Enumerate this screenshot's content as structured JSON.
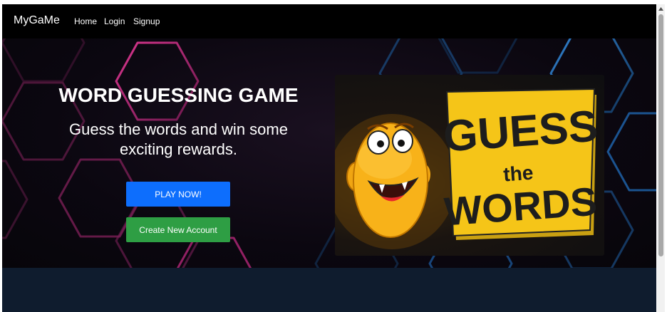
{
  "navbar": {
    "brand": "MyGaMe",
    "links": [
      {
        "label": "Home"
      },
      {
        "label": "Login"
      },
      {
        "label": "Signup"
      }
    ]
  },
  "hero": {
    "title": "WORD GUESSING GAME",
    "subtitle": "Guess the words and win some exciting rewards.",
    "play_button": "PLAY NOW!",
    "create_button": "Create New Account"
  },
  "game_logo": {
    "line1": "GUESS",
    "line2": "the",
    "line3": "WORDS"
  },
  "icons": {
    "mascot": "smiling-orange-mascot-icon",
    "scroll_up": "chevron-up-icon"
  },
  "colors": {
    "navbar_bg": "#000000",
    "play_button": "#0d6efd",
    "create_button": "#2e9e44",
    "logo_yellow": "#f5c518",
    "section_bg": "#0f1c2e"
  }
}
